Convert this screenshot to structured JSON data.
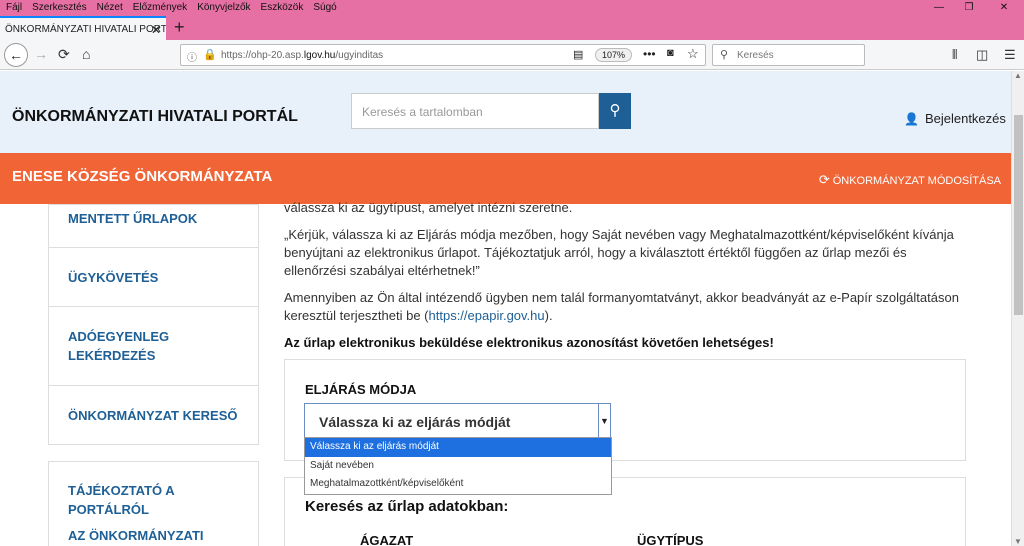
{
  "browser": {
    "menu": [
      "Fájl",
      "Szerkesztés",
      "Nézet",
      "Előzmények",
      "Könyvjelzők",
      "Eszközök",
      "Súgó"
    ],
    "tab_title": "ÖNKORMÁNYZATI HIVATALI PORT",
    "url_prefix": "https://ohp-20.asp.",
    "url_domain": "lgov.hu",
    "url_path": "/ugyinditas",
    "zoom": "107%",
    "search_placeholder": "Keresés"
  },
  "header": {
    "portal_title": "ÖNKORMÁNYZATI HIVATALI PORTÁL",
    "search_placeholder": "Keresés a tartalomban",
    "login": "Bejelentkezés"
  },
  "municipality": {
    "name": "ENESE KÖZSÉG ÖNKORMÁNYZATA",
    "change": "ÖNKORMÁNYZAT MÓDOSÍTÁSA"
  },
  "sidebar": {
    "items": [
      "MENTETT ŰRLAPOK",
      "ÜGYKÖVETÉS",
      "ADÓEGYENLEG LEKÉRDEZÉS",
      "ÖNKORMÁNYZAT KERESŐ"
    ],
    "items2": [
      "TÁJÉKOZTATÓ A PORTÁLRÓL",
      "AZ ÖNKORMÁNYZATI"
    ]
  },
  "content": {
    "p0": "válassza ki az ügytípust, amelyet intézni szeretne.",
    "p1": "„Kérjük, válassza ki az Eljárás módja mezőben, hogy Saját nevében vagy Meghatalmazottként/képviselőként kívánja benyújtani az elektronikus űrlapot. Tájékoztatjuk arról, hogy a kiválasztott értéktől függően az űrlap mezői és ellenőrzési szabályai eltérhetnek!”",
    "p2_pre": "Amennyiben az Ön által intézendő ügyben nem talál formanyomtatványt, akkor beadványát az e-Papír szolgáltatáson keresztül terjesztheti be (",
    "p2_link": "https://epapir.gov.hu",
    "p2_post": ").",
    "p3": "Az űrlap elektronikus beküldése elektronikus azonosítást követően lehetséges!"
  },
  "form": {
    "label": "ELJÁRÁS MÓDJA",
    "selected": "Válassza ki az eljárás módját",
    "options": [
      "Válassza ki az eljárás módját",
      "Saját nevében",
      "Meghatalmazottként/képviselőként"
    ]
  },
  "search_section": {
    "heading": "Keresés az űrlap adatokban:",
    "col1": "ÁGAZAT",
    "col2": "ÜGYTÍPUS"
  }
}
